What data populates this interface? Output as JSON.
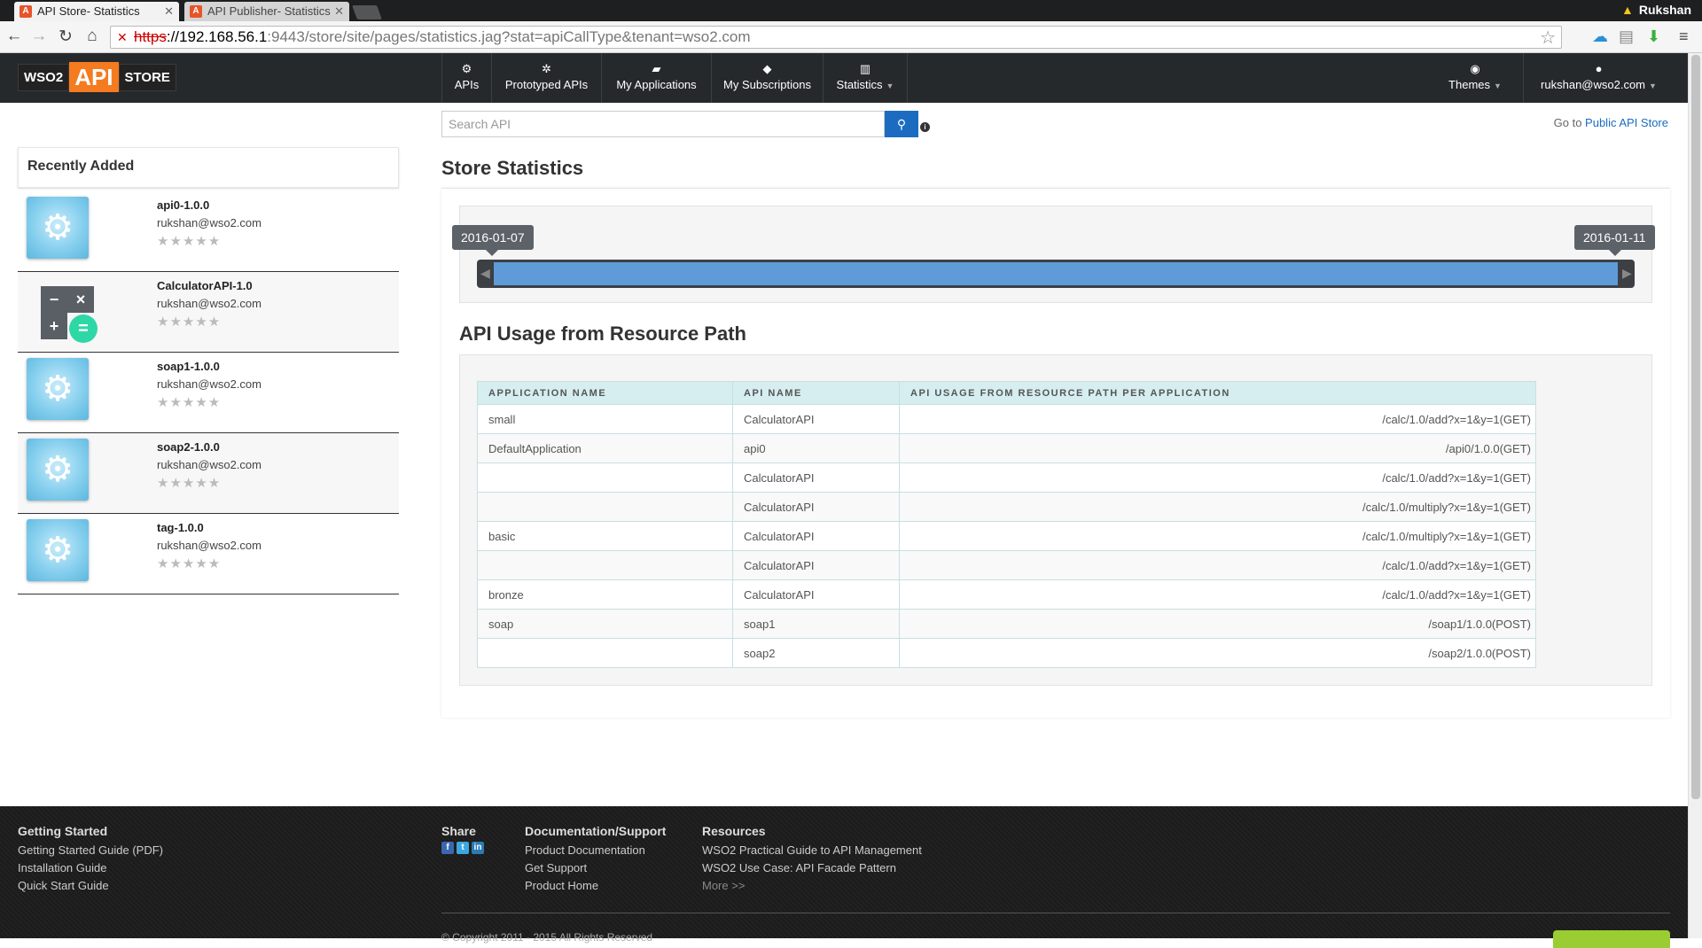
{
  "browser": {
    "tabs": [
      {
        "title": "API Store- Statistics",
        "active": true
      },
      {
        "title": "API Publisher- Statistics",
        "active": false
      }
    ],
    "profile_name": "Rukshan",
    "url_scheme": "https",
    "url_host": "://192.168.56.1",
    "url_rest": ":9443/store/site/pages/statistics.jag?stat=apiCallType&tenant=wso2.com"
  },
  "header": {
    "logo": {
      "brand": "WSO2",
      "api": "API",
      "product": "STORE"
    },
    "menu": [
      {
        "label": "APIs",
        "icon": "cogs-icon"
      },
      {
        "label": "Prototyped APIs",
        "icon": "cog-icon"
      },
      {
        "label": "My Applications",
        "icon": "briefcase-icon"
      },
      {
        "label": "My Subscriptions",
        "icon": "tags-icon"
      },
      {
        "label": "Statistics",
        "icon": "bar-chart-icon"
      }
    ],
    "themes_label": "Themes",
    "user_label": "rukshan@wso2.com"
  },
  "sidebar": {
    "title": "Recently Added",
    "items": [
      {
        "name": "api0-1.0.0",
        "owner": "rukshan@wso2.com",
        "rating": "★★★★★"
      },
      {
        "name": "CalculatorAPI-1.0",
        "owner": "rukshan@wso2.com",
        "rating": "★★★★★"
      },
      {
        "name": "soap1-1.0.0",
        "owner": "rukshan@wso2.com",
        "rating": "★★★★★"
      },
      {
        "name": "soap2-1.0.0",
        "owner": "rukshan@wso2.com",
        "rating": "★★★★★"
      },
      {
        "name": "tag-1.0.0",
        "owner": "rukshan@wso2.com",
        "rating": "★★★★★"
      }
    ]
  },
  "search": {
    "placeholder": "Search API"
  },
  "goto": {
    "prefix": "Go to",
    "link": "Public API Store"
  },
  "main": {
    "title": "Store Statistics",
    "date_from": "2016-01-07",
    "date_to": "2016-01-11",
    "usage_title": "API Usage from Resource Path",
    "table": {
      "headers": [
        "APPLICATION NAME",
        "API NAME",
        "API USAGE FROM RESOURCE PATH PER APPLICATION"
      ],
      "rows": [
        [
          "small",
          "CalculatorAPI",
          "/calc/1.0/add?x=1&y=1(GET)"
        ],
        [
          "DefaultApplication",
          "api0",
          "/api0/1.0.0(GET)"
        ],
        [
          "",
          "CalculatorAPI",
          "/calc/1.0/add?x=1&y=1(GET)"
        ],
        [
          "",
          "CalculatorAPI",
          "/calc/1.0/multiply?x=1&y=1(GET)"
        ],
        [
          "basic",
          "CalculatorAPI",
          "/calc/1.0/multiply?x=1&y=1(GET)"
        ],
        [
          "",
          "CalculatorAPI",
          "/calc/1.0/add?x=1&y=1(GET)"
        ],
        [
          "bronze",
          "CalculatorAPI",
          "/calc/1.0/add?x=1&y=1(GET)"
        ],
        [
          "soap",
          "soap1",
          "/soap1/1.0.0(POST)"
        ],
        [
          "",
          "soap2",
          "/soap2/1.0.0(POST)"
        ]
      ]
    }
  },
  "footer": {
    "getting_started": {
      "title": "Getting Started",
      "links": [
        "Getting Started Guide (PDF)",
        "Installation Guide",
        "Quick Start Guide"
      ]
    },
    "share": {
      "title": "Share"
    },
    "docs": {
      "title": "Documentation/Support",
      "links": [
        "Product Documentation",
        "Get Support",
        "Product Home"
      ]
    },
    "resources": {
      "title": "Resources",
      "links": [
        "WSO2 Practical Guide to API Management",
        "WSO2 Use Case: API Facade Pattern"
      ],
      "more": "More >>"
    },
    "copyright": "© Copyright 2011 - 2015 All Rights Reserved"
  }
}
